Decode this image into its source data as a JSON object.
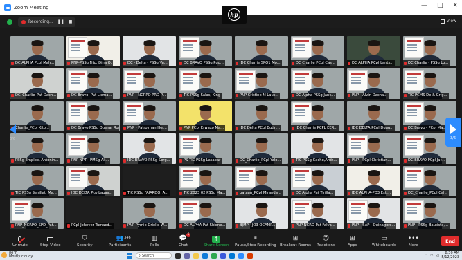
{
  "window": {
    "title": "Zoom Meeting",
    "controls": [
      "—",
      "□",
      "✕"
    ]
  },
  "topbar": {
    "recording_label": "Recording...",
    "pause_glyph": "❚❚",
    "stop_glyph": "■",
    "view_label": "View"
  },
  "camera_brand": "hp",
  "pagination": {
    "left_label": "3/6",
    "right_label": "3/6"
  },
  "participants": [
    "DC ALPHA Pcpl Mah...",
    "PNP-PSSg Fito, Dina Q.",
    "DC - Delta - PSSg Va...",
    "DC BRAVO PSSg Pud...",
    "IDC Charlie SPO1 Mo...",
    "DC Charlie PCpl Cas...",
    "DC ALPHA PCpl Lants...",
    "DC Charlie - PSSg Lo...",
    "DC_Charlie_Pat Dach...",
    "DC Bravo- Pat Liema...",
    "PNP - NCRPO PRD-P...",
    "TIC PSSg Salas, King",
    "PNP Cristine M Laus...",
    "DC Alpha PSSg Janc...",
    "PNP - Alvin Dacha...",
    "TIC PCMS De & Grig...",
    "Charlie_PCpl Kito...",
    "DC Bravo PSSg Ogena, Rose F...",
    "PNP - Patrolman Her...",
    "PNP PCpl Erwaxo Ma...",
    "IDC Delta PCpl Butin...",
    "IDC Charlie PCPL EER...",
    "IDC DELTA PCpl Duqu...",
    "DC Bravo - PCpl Ma...",
    "PSSg Empleo, Antonin...",
    "PNP NPTI- PMSg Ak...",
    "IDC BRAVO PSSg Serg...",
    "PS TIC PSSg Lasabar",
    "DC_Charlie_PCpl Yalo...",
    "TIC PSSg Cacho,Anth...",
    "PNP - PCpl Christian...",
    "DC BRAVO PCpl Jar...",
    "TIC PSSg Senillat, Ma...",
    "IDC DELTA Pcp Lagas...",
    "TIC PSSg FAJARDO, A...",
    "TIC 2023 02 PSSg Ma...",
    "bataan_PCpl Miranda...",
    "DC Alpha Pat Tirilla...",
    "IDC ALPHA-PO3 Esti...",
    "DC_Charlie_PCpl Cal...",
    "PNP_NCRPO_SPD_Pat...",
    "PCpl Johnver Tumacd...",
    "PNP Pymie Grielle W...",
    "DC ALPHA Pat Shione...",
    "BJMP - JO3 OCAMP...",
    "PNP NCRO Pat Falva...",
    "PNP - SAP - Quinagoro...",
    "PNP - PSSg Bautista,..."
  ],
  "toolbar": {
    "unmute": "Unmute",
    "stop_video": "Stop Video",
    "security": "Security",
    "participants": "Participants",
    "participants_count": "346",
    "polls": "Polls",
    "chat": "Chat",
    "chat_badge": "6",
    "share_screen": "Share Screen",
    "pause_recording": "Pause/Stop Recording",
    "breakout": "Breakout Rooms",
    "reactions": "Reactions",
    "apps": "Apps",
    "whiteboards": "Whiteboards",
    "more": "More",
    "end": "End"
  },
  "taskbar": {
    "temperature": "86°F",
    "weather": "Mostly cloudy",
    "search": "Search",
    "time": "8:30 AM",
    "date": "5/12/2023"
  },
  "colors": {
    "accent": "#2d8cff",
    "end": "#e02c2c",
    "share": "#22b14c",
    "muted": "#e02c2c"
  }
}
